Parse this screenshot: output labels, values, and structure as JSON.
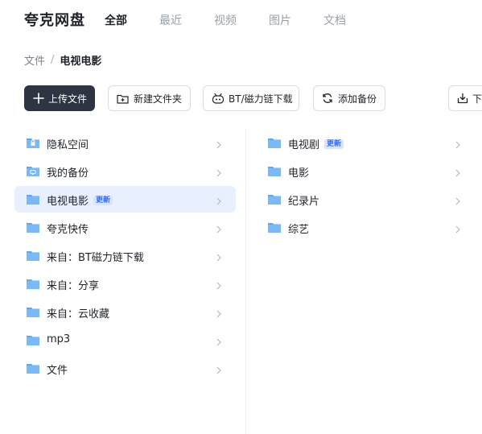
{
  "app": {
    "title": "夸克网盘"
  },
  "nav": {
    "tabs": [
      {
        "label": "全部",
        "active": true
      },
      {
        "label": "最近",
        "active": false
      },
      {
        "label": "视频",
        "active": false
      },
      {
        "label": "图片",
        "active": false
      },
      {
        "label": "文档",
        "active": false
      }
    ]
  },
  "breadcrumb": {
    "root": "文件",
    "separator": "/",
    "current": "电视电影"
  },
  "toolbar": {
    "upload_label": "上传文件",
    "new_folder_label": "新建文件夹",
    "bt_label": "BT/磁力链下载",
    "backup_label": "添加备份",
    "download_label": "下"
  },
  "sidebar": {
    "items": [
      {
        "label": "隐私空间",
        "icon": "lock-folder-icon",
        "badge": ""
      },
      {
        "label": "我的备份",
        "icon": "backup-folder-icon",
        "badge": ""
      },
      {
        "label": "电视电影",
        "icon": "folder-icon",
        "badge": "更新",
        "selected": true
      },
      {
        "label": "夸克快传",
        "icon": "folder-icon",
        "badge": ""
      },
      {
        "label": "来自：BT磁力链下载",
        "icon": "folder-icon",
        "badge": ""
      },
      {
        "label": "来自：分享",
        "icon": "folder-icon",
        "badge": ""
      },
      {
        "label": "来自：云收藏",
        "icon": "folder-icon",
        "badge": ""
      },
      {
        "label": "mp3",
        "icon": "folder-icon",
        "badge": ""
      },
      {
        "label": "文件",
        "icon": "folder-icon",
        "badge": ""
      }
    ]
  },
  "subfolders": {
    "items": [
      {
        "label": "电视剧",
        "icon": "folder-icon",
        "badge": "更新"
      },
      {
        "label": "电影",
        "icon": "folder-icon",
        "badge": ""
      },
      {
        "label": "纪录片",
        "icon": "folder-icon",
        "badge": ""
      },
      {
        "label": "综艺",
        "icon": "folder-icon",
        "badge": ""
      }
    ]
  },
  "colors": {
    "folder": "#5aa9f5",
    "folder_dark": "#3f8fe6",
    "selected_bg": "#e8efff",
    "badge_bg": "#d7e3ff",
    "badge_text": "#2f6bff",
    "primary_button": "#2e3442"
  }
}
